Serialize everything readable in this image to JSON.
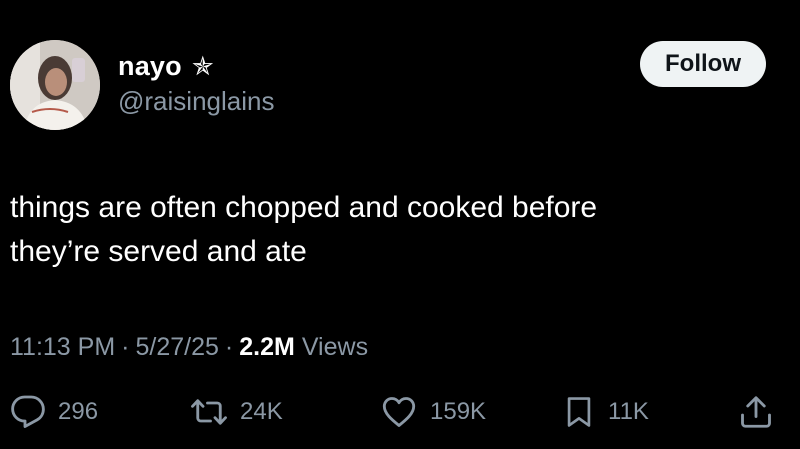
{
  "author": {
    "display_name": "nayo",
    "name_symbol": "✯",
    "handle": "@raisinglains"
  },
  "follow_button": {
    "label": "Follow"
  },
  "tweet": {
    "line1": "things are often chopped and cooked before",
    "line2": "they’re served and ate"
  },
  "meta": {
    "time": "11:13 PM",
    "separator": "·",
    "date": "5/27/25",
    "views_count": "2.2M",
    "views_label": "Views"
  },
  "actions": {
    "replies": "296",
    "reposts": "24K",
    "likes": "159K",
    "bookmarks": "11K"
  },
  "colors": {
    "background": "#000000",
    "text_primary": "#ffffff",
    "text_secondary": "#8b98a5",
    "follow_bg": "#eff3f4",
    "follow_text": "#0f1419"
  },
  "icons": {
    "reply": "speech-bubble-icon",
    "repost": "repost-arrows-icon",
    "like": "heart-icon",
    "bookmark": "bookmark-icon",
    "share": "share-upload-icon",
    "badge": "star-icon"
  }
}
